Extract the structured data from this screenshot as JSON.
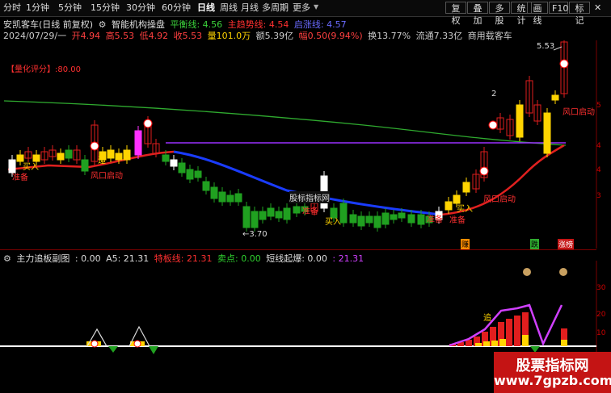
{
  "toolbar": {
    "periods": [
      "分时",
      "1分钟",
      "5分钟",
      "15分钟",
      "30分钟",
      "60分钟",
      "日线",
      "周线",
      "月线",
      "多周期",
      "更多"
    ],
    "active_period": "日线",
    "right_buttons": [
      "复权",
      "叠加",
      "多股",
      "统计",
      "画线",
      "F10",
      "标记"
    ]
  },
  "header": {
    "title": "安凯客车(日线 前复权)",
    "indicator": "智能机构操盘",
    "ph_label": "平衡线: 4.56",
    "zl_label": "主趋势线: 4.54",
    "qz_label": "启涨线: 4.57",
    "date": "2024/07/29/一",
    "open": "开4.94",
    "high": "高5.53",
    "low": "低4.92",
    "close": "收5.53",
    "volume": "量101.0万",
    "amount": "额5.39亿",
    "amp": "幅0.50(9.94%)",
    "turnover": "换13.77%",
    "float": "流通7.33亿",
    "industry": "商用载客车"
  },
  "main": {
    "score": "【量化评分】:80.00",
    "high_price": "5.53",
    "low_price": "←3.70",
    "label_2": "2",
    "tags": [
      "准备",
      "买入",
      "风口启动",
      "追",
      "风口启动",
      "准备",
      "股标指标网",
      "买入",
      "准备",
      "风口启动",
      "买入",
      "准备",
      "风口启动"
    ],
    "bottom_tags": [
      "赚",
      "跌",
      "涨榜"
    ],
    "axis": [
      "5",
      "4",
      "4",
      "3"
    ]
  },
  "sub": {
    "title": "主力追板副图",
    "v1": ": 0.00",
    "a5": "A5: 21.31",
    "tb": "特板线: 21.31",
    "sell": "卖点: 0.00",
    "short": "短线起爆: 0.00",
    "val": ": 21.31",
    "axis": [
      "30",
      "20",
      "10"
    ],
    "zhui": "追"
  },
  "watermark": {
    "line1": "股票指标网",
    "line2": "www.7gpzb.com"
  },
  "chart_data": {
    "type": "candlestick",
    "title": "安凯客车(日线 前复权)",
    "last": {
      "date": "2024/07/29",
      "open": 4.94,
      "high": 5.53,
      "low": 4.92,
      "close": 5.53
    },
    "low_marked": 3.7,
    "high_marked": 5.53
  }
}
